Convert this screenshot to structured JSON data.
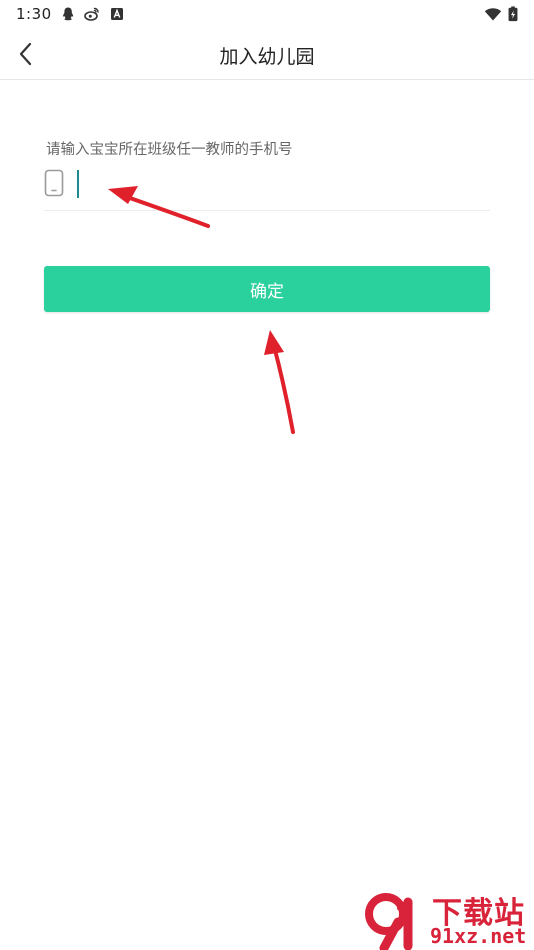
{
  "status_bar": {
    "time": "1:30",
    "icons_left": [
      "qq-icon",
      "weibo-icon",
      "a-notification-icon"
    ],
    "icons_right": [
      "wifi-icon",
      "battery-charging-icon"
    ]
  },
  "header": {
    "title": "加入幼儿园",
    "back_icon": "chevron-left-icon"
  },
  "form": {
    "hint": "请输入宝宝所在班级任一教师的手机号",
    "phone_value": "",
    "phone_icon": "mobile-phone-icon",
    "accent_color": "#1e8b8e"
  },
  "confirm": {
    "label": "确定",
    "color": "#2bd19c"
  },
  "annotations": {
    "arrow_color": "#e0202a"
  },
  "watermark": {
    "brand": "下载站",
    "url": "91xz.net",
    "color": "#d9233a"
  }
}
